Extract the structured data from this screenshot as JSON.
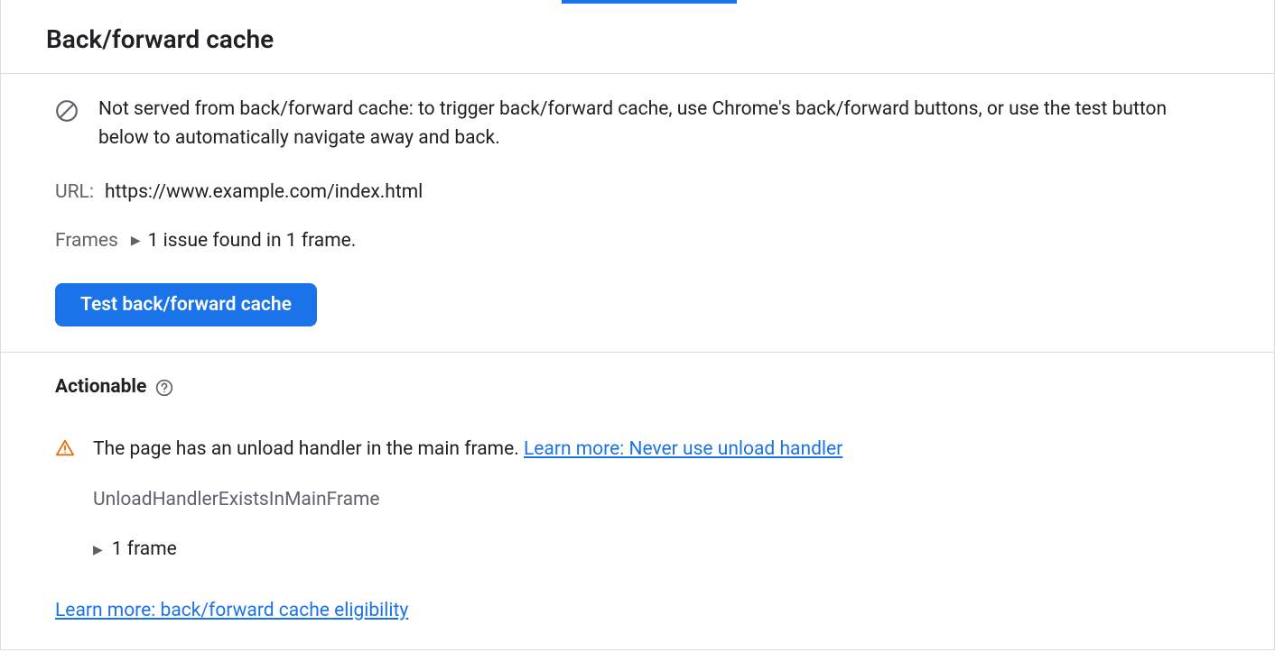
{
  "header": {
    "title": "Back/forward cache"
  },
  "main": {
    "info_message": "Not served from back/forward cache: to trigger back/forward cache, use Chrome's back/forward buttons, or use the test button below to automatically navigate away and back.",
    "url_label": "URL:",
    "url_value": "https://www.example.com/index.html",
    "frames_label": "Frames",
    "frames_summary": "1 issue found in 1 frame.",
    "test_button_label": "Test back/forward cache"
  },
  "actionable": {
    "heading": "Actionable",
    "issue_text": "The page has an unload handler in the main frame. ",
    "issue_learn_more": "Learn more: Never use unload handler",
    "issue_code": "UnloadHandlerExistsInMainFrame",
    "frame_count": "1 frame",
    "eligibility_link": "Learn more: back/forward cache eligibility"
  }
}
